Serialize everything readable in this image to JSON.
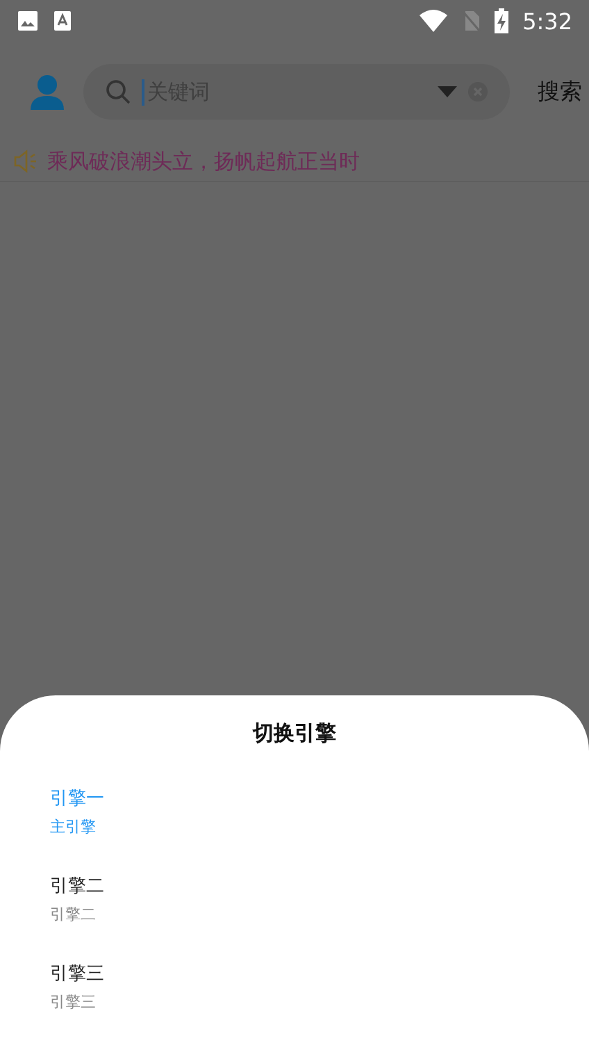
{
  "status_bar": {
    "time": "5:32"
  },
  "header": {
    "search": {
      "placeholder": "关键词"
    },
    "search_button": "搜索"
  },
  "notice": {
    "text": "乘风破浪潮头立，扬帆起航正当时"
  },
  "sheet": {
    "title": "切换引擎",
    "engines": [
      {
        "name": "引擎一",
        "subtitle": "主引擎",
        "selected": true
      },
      {
        "name": "引擎二",
        "subtitle": "引擎二",
        "selected": false
      },
      {
        "name": "引擎三",
        "subtitle": "引擎三",
        "selected": false
      }
    ]
  }
}
